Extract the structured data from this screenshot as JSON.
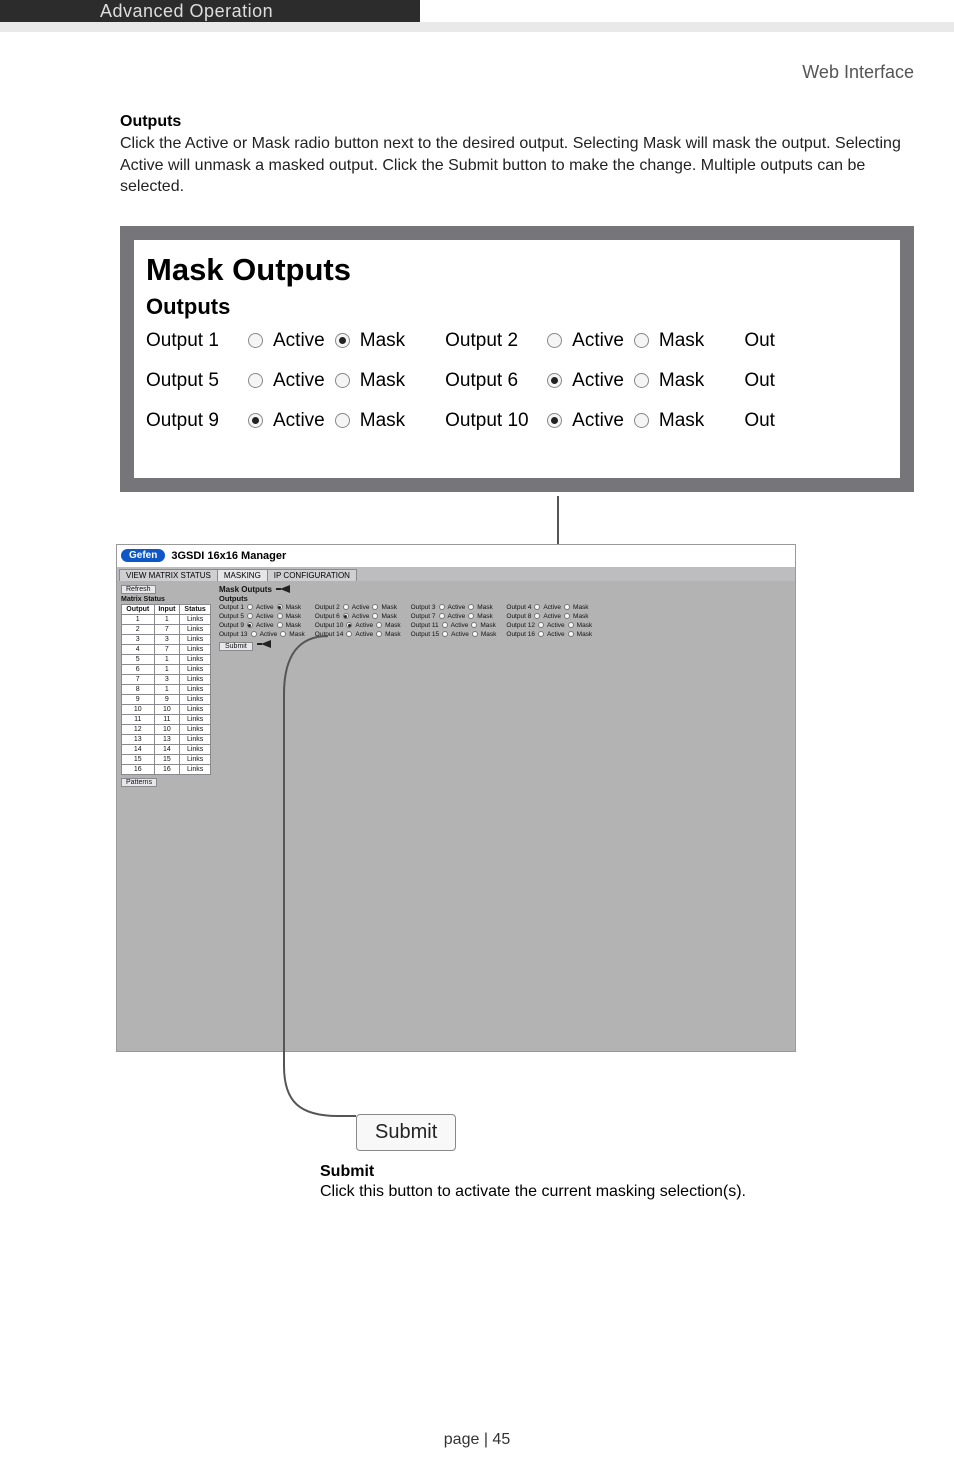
{
  "header": {
    "chapter": "Advanced Operation",
    "section": "Web Interface"
  },
  "outputs_section": {
    "title": "Outputs",
    "body": "Click the Active or Mask radio button next to the desired output.  Selecting Mask will mask the output.  Selecting Active will unmask a masked output.  Click the Submit button to make the change.  Multiple outputs can be selected."
  },
  "mask_panel": {
    "h1": "Mask Outputs",
    "h2": "Outputs",
    "active_label": "Active",
    "mask_label": "Mask",
    "cutoff_out_right": "Out",
    "rows": [
      [
        {
          "label": "Output 1",
          "selected": "mask"
        },
        {
          "label": "Output 2",
          "selected": "none"
        },
        {
          "label": "Out",
          "clip": true
        }
      ],
      [
        {
          "label": "Output 5",
          "selected": "none"
        },
        {
          "label": "Output 6",
          "selected": "active"
        },
        {
          "label": "Out",
          "clip": true
        }
      ],
      [
        {
          "label": "Output 9",
          "selected": "active"
        },
        {
          "label": "Output 10",
          "selected": "active"
        },
        {
          "label": "Out",
          "clip": true
        }
      ]
    ]
  },
  "app_shot": {
    "logo": "Gefen",
    "title": "3GSDI 16x16 Manager",
    "tabs": {
      "view": "VIEW MATRIX STATUS",
      "masking": "MASKING",
      "ip": "IP CONFIGURATION"
    },
    "refresh": "Refresh",
    "matrix_status_label": "Matrix Status",
    "patterns": "Patterns",
    "table": {
      "headers": [
        "Output",
        "Input",
        "Status"
      ],
      "status_val": "Links",
      "rows": [
        [
          1,
          1
        ],
        [
          2,
          7
        ],
        [
          3,
          3
        ],
        [
          4,
          7
        ],
        [
          5,
          1
        ],
        [
          6,
          1
        ],
        [
          7,
          3
        ],
        [
          8,
          1
        ],
        [
          9,
          9
        ],
        [
          10,
          10
        ],
        [
          11,
          11
        ],
        [
          12,
          10
        ],
        [
          13,
          13
        ],
        [
          14,
          14
        ],
        [
          15,
          15
        ],
        [
          16,
          16
        ]
      ]
    },
    "main_title": "Mask Outputs",
    "main_sub": "Outputs",
    "active": "Active",
    "mask": "Mask",
    "submit": "Submit",
    "rows": [
      [
        {
          "n": 1,
          "sel": "mask"
        },
        {
          "n": 2,
          "sel": "none"
        },
        {
          "n": 3,
          "sel": "none"
        },
        {
          "n": 4,
          "sel": "none"
        }
      ],
      [
        {
          "n": 5,
          "sel": "none"
        },
        {
          "n": 6,
          "sel": "active"
        },
        {
          "n": 7,
          "sel": "none"
        },
        {
          "n": 8,
          "sel": "none"
        }
      ],
      [
        {
          "n": 9,
          "sel": "active"
        },
        {
          "n": 10,
          "sel": "active"
        },
        {
          "n": 11,
          "sel": "none"
        },
        {
          "n": 12,
          "sel": "none"
        }
      ],
      [
        {
          "n": 13,
          "sel": "none"
        },
        {
          "n": 14,
          "sel": "none"
        },
        {
          "n": 15,
          "sel": "none"
        },
        {
          "n": 16,
          "sel": "none"
        }
      ]
    ]
  },
  "submit_callout": {
    "button": "Submit",
    "heading": "Submit",
    "body": "Click this button to activate the current masking selection(s)."
  },
  "footer": "page | 45"
}
